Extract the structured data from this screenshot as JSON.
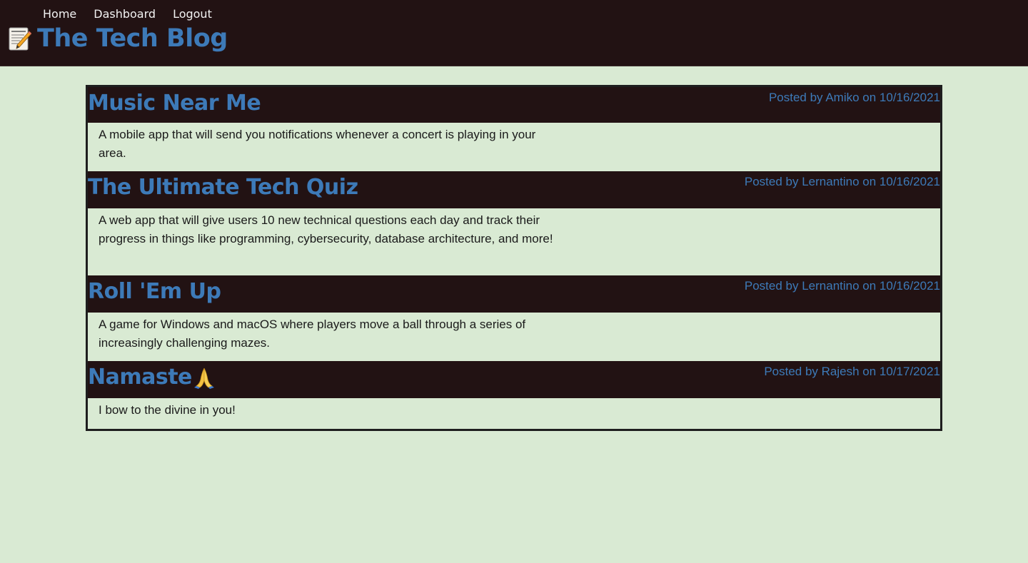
{
  "nav": {
    "items": [
      {
        "label": "Home"
      },
      {
        "label": "Dashboard"
      },
      {
        "label": "Logout"
      }
    ]
  },
  "brand": {
    "icon": "memo-icon",
    "title": "The Tech Blog"
  },
  "colors": {
    "header_bg": "#221213",
    "page_bg": "#d9ead3",
    "accent": "#3d7ab8",
    "nav_text": "#f2f2f2"
  },
  "posts": [
    {
      "title": "Music Near Me",
      "meta": "Posted by Amiko on 10/16/2021",
      "body": "A mobile app that will send you notifications whenever a concert is playing in your area."
    },
    {
      "title": "The Ultimate Tech Quiz",
      "meta": "Posted by Lernantino on 10/16/2021",
      "body": "A web app that will give users 10 new technical questions each day and track their progress in things like programming, cybersecurity, database architecture, and more!"
    },
    {
      "title": "Roll 'Em Up",
      "meta": "Posted by Lernantino on 10/16/2021",
      "body": "A game for Windows and macOS where players move a ball through a series of increasingly challenging mazes."
    },
    {
      "title": "Namaste",
      "title_icon": "folded-hands-icon",
      "meta": "Posted by Rajesh on 10/17/2021",
      "body": "I bow to the divine in you!"
    }
  ]
}
